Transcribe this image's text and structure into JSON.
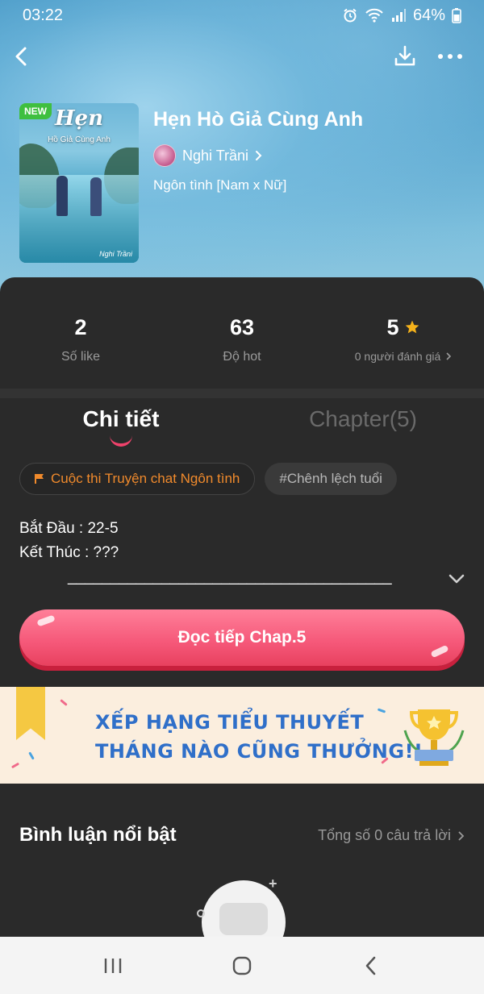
{
  "status_bar": {
    "time": "03:22",
    "battery": "64%"
  },
  "book": {
    "title": "Hẹn Hò Giả Cùng Anh",
    "author": "Nghi Trầni",
    "genre": "Ngôn tình [Nam x Nữ]",
    "cover": {
      "badge": "NEW",
      "title_art": "Hẹn",
      "subtitle_art": "Hồ Giả Cùng Anh",
      "signature": "Nghi Trầni"
    }
  },
  "stats": [
    {
      "value": "2",
      "label": "Số like"
    },
    {
      "value": "63",
      "label": "Độ hot"
    },
    {
      "value": "5",
      "label": "0 người đánh giá"
    }
  ],
  "tabs": [
    {
      "label": "Chi tiết",
      "active": true
    },
    {
      "label": "Chapter(5)",
      "active": false
    }
  ],
  "chips": {
    "contest": "Cuộc thi Truyện chat Ngôn tình",
    "tag": "#Chênh lệch tuổi"
  },
  "description": {
    "line1": "Bắt Đầu : 22-5",
    "line2": "Kết Thúc : ???",
    "line3": "______________________________________"
  },
  "read_button": {
    "label": "Đọc tiếp Chap.5"
  },
  "banner": {
    "line1": "XẾP HẠNG TIỂU THUYẾT",
    "line2": "THÁNG NÀO CŨNG THƯỞNG!!"
  },
  "comments": {
    "title": "Bình luận nổi bật",
    "count_text": "Tổng số 0 câu trả lời"
  },
  "colors": {
    "accent": "#f55778",
    "contest": "#f08a2c",
    "star": "#f5b21b",
    "banner_text": "#2f6fc9",
    "panel_bg": "#2a2a2a"
  },
  "icons": {
    "back": "chevron-left-icon",
    "download": "download-icon",
    "more": "more-horizontal-icon",
    "star": "star-icon",
    "flag": "flag-icon",
    "expand": "chevron-down-icon",
    "nav_recents": "recents-icon",
    "nav_home": "home-icon",
    "nav_back": "back-icon"
  }
}
